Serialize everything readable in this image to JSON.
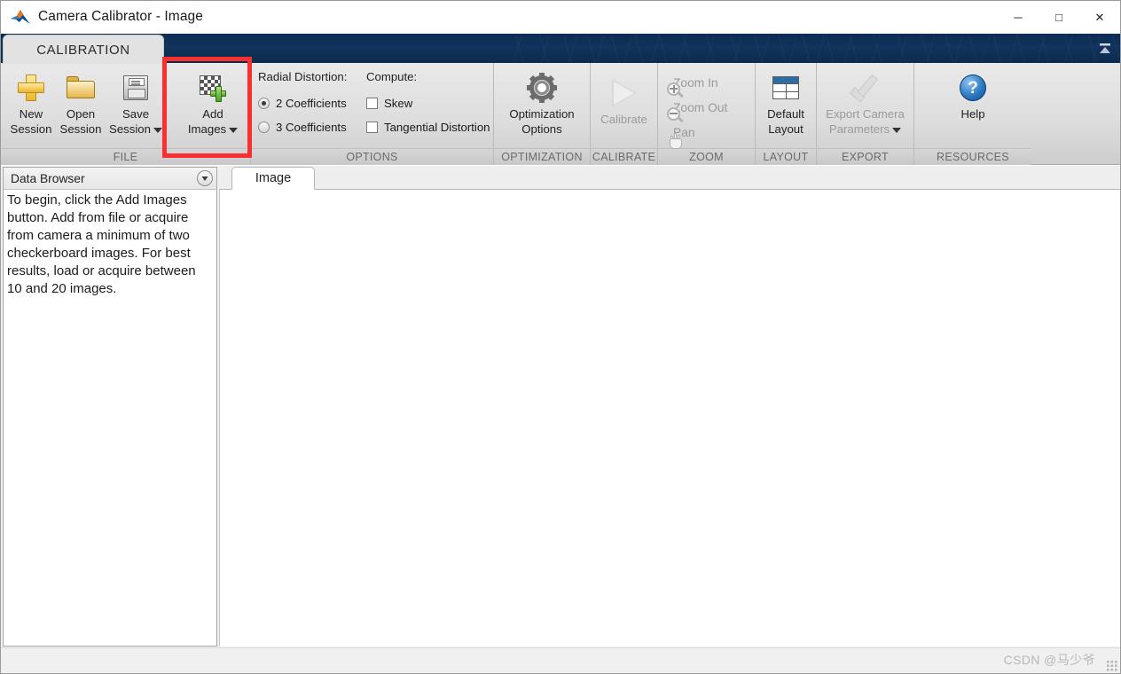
{
  "window": {
    "title": "Camera Calibrator - Image",
    "app_icon": "matlab-icon",
    "minimize_label": "─",
    "maximize_label": "□",
    "close_label": "✕"
  },
  "ribbon": {
    "tab_label": "CALIBRATION",
    "collapse_icon": "ribbon-collapse-icon",
    "groups": [
      {
        "label": "FILE",
        "items": [
          {
            "name": "new-session",
            "line1": "New",
            "line2": "Session",
            "icon": "plus-icon",
            "enabled": true,
            "dropdown": false
          },
          {
            "name": "open-session",
            "line1": "Open",
            "line2": "Session",
            "icon": "folder-icon",
            "enabled": true,
            "dropdown": false
          },
          {
            "name": "save-session",
            "line1": "Save",
            "line2": "Session",
            "icon": "floppy-disk-icon",
            "enabled": true,
            "dropdown": true
          },
          {
            "name": "add-images",
            "line1": "Add",
            "line2": "Images",
            "icon": "checkerboard-plus-icon",
            "enabled": true,
            "dropdown": true
          }
        ]
      },
      {
        "label": "OPTIONS",
        "radial_header": "Radial Distortion:",
        "compute_header": "Compute:",
        "radios": [
          {
            "label": "2 Coefficients",
            "selected": true
          },
          {
            "label": "3 Coefficients",
            "selected": false
          }
        ],
        "checkboxes": [
          {
            "label": "Skew",
            "checked": false
          },
          {
            "label": "Tangential Distortion",
            "checked": false
          }
        ]
      },
      {
        "label": "OPTIMIZATION",
        "items": [
          {
            "name": "optimization-options",
            "line1": "Optimization",
            "line2": "Options",
            "icon": "gear-icon",
            "enabled": true,
            "dropdown": false
          }
        ]
      },
      {
        "label": "CALIBRATE",
        "items": [
          {
            "name": "calibrate",
            "line1": "Calibrate",
            "line2": "",
            "icon": "play-triangle-icon",
            "enabled": false,
            "dropdown": false
          }
        ]
      },
      {
        "label": "ZOOM",
        "items": [
          {
            "name": "zoom-in",
            "label": "Zoom In",
            "icon": "zoom-in-icon",
            "enabled": false
          },
          {
            "name": "zoom-out",
            "label": "Zoom Out",
            "icon": "zoom-out-icon",
            "enabled": false
          },
          {
            "name": "pan",
            "label": "Pan",
            "icon": "pan-hand-icon",
            "enabled": false
          }
        ]
      },
      {
        "label": "LAYOUT",
        "items": [
          {
            "name": "default-layout",
            "line1": "Default",
            "line2": "Layout",
            "icon": "layout-grid-icon",
            "enabled": true,
            "dropdown": false
          }
        ]
      },
      {
        "label": "EXPORT",
        "items": [
          {
            "name": "export-camera-parameters",
            "line1": "Export Camera",
            "line2": "Parameters",
            "icon": "checkmark-icon",
            "enabled": false,
            "dropdown": true
          }
        ]
      },
      {
        "label": "RESOURCES",
        "items": [
          {
            "name": "help",
            "line1": "Help",
            "line2": "",
            "icon": "help-circle-icon",
            "enabled": true,
            "dropdown": false
          }
        ]
      }
    ]
  },
  "highlight": {
    "target": "add-images",
    "color": "#f9302f"
  },
  "data_browser": {
    "title": "Data Browser",
    "menu_icon": "chevron-down-circle-icon",
    "message": "To begin, click the Add Images button. Add from file or acquire from camera a minimum of two checkerboard images. For best results, load or acquire between 10 and 20 images."
  },
  "document_area": {
    "tab_label": "Image",
    "grip_icon": "drag-grip-icon"
  },
  "status_bar": {
    "watermark": "CSDN @马少爷",
    "resize_grip_icon": "resize-grip-icon"
  }
}
